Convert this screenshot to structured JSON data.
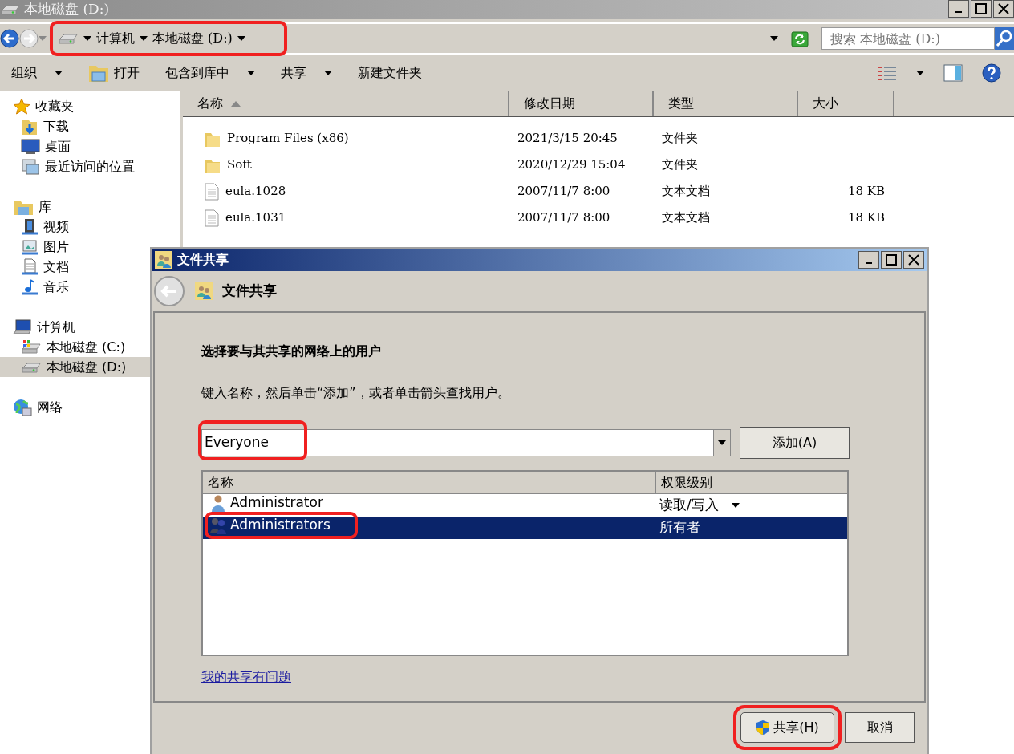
{
  "window": {
    "title": "本地磁盘 (D:)"
  },
  "address_bar": {
    "crumbs": [
      "计算机",
      "本地磁盘 (D:)"
    ],
    "highlighted": true
  },
  "search": {
    "placeholder": "搜索 本地磁盘 (D:)"
  },
  "toolbar": [
    {
      "label": "组织",
      "kind": "menu"
    },
    {
      "label": "打开",
      "kind": "open"
    },
    {
      "label": "包含到库中",
      "kind": "menu"
    },
    {
      "label": "共享",
      "kind": "menu"
    },
    {
      "label": "新建文件夹",
      "kind": "plain"
    }
  ],
  "nav": [
    {
      "label": "收藏夹",
      "kind": "favorites",
      "selected": false,
      "children": [
        {
          "label": "下载",
          "kind": "downloads",
          "selected": false
        },
        {
          "label": "桌面",
          "kind": "desktop",
          "selected": false
        },
        {
          "label": "最近访问的位置",
          "kind": "recent",
          "selected": false
        }
      ]
    },
    {
      "label": "库",
      "kind": "library",
      "selected": false,
      "children": [
        {
          "label": "视频",
          "kind": "video",
          "selected": false
        },
        {
          "label": "图片",
          "kind": "pictures",
          "selected": false
        },
        {
          "label": "文档",
          "kind": "documents",
          "selected": false
        },
        {
          "label": "音乐",
          "kind": "music",
          "selected": false
        }
      ]
    },
    {
      "label": "计算机",
      "kind": "computer",
      "selected": false,
      "children": [
        {
          "label": "本地磁盘 (C:)",
          "kind": "system-drive",
          "selected": false
        },
        {
          "label": "本地磁盘 (D:)",
          "kind": "drive",
          "selected": true
        }
      ]
    },
    {
      "label": "网络",
      "kind": "network",
      "selected": false
    }
  ],
  "files": {
    "columns": [
      {
        "label": "名称",
        "sorted": true
      },
      {
        "label": "修改日期",
        "sorted": false
      },
      {
        "label": "类型",
        "sorted": false
      },
      {
        "label": "大小",
        "sorted": false
      }
    ],
    "rows": [
      {
        "kind": "folder",
        "name": "Program Files (x86)",
        "modified": "2021/3/15 20:45",
        "type": "文件夹"
      },
      {
        "kind": "folder",
        "name": "Soft",
        "modified": "2020/12/29 15:04",
        "type": "文件夹"
      },
      {
        "kind": "text",
        "name": "eula.1028",
        "modified": "2007/11/7 8:00",
        "type": "文本文档",
        "size": "18 KB"
      },
      {
        "kind": "text",
        "name": "eula.1031",
        "modified": "2007/11/7 8:00",
        "type": "文本文档",
        "size": "18 KB"
      }
    ]
  },
  "share_dialog": {
    "title": "文件共享",
    "header": "文件共享",
    "heading": "选择要与其共享的网络上的用户",
    "instruction": "键入名称，然后单击“添加”，或者单击箭头查找用户。",
    "name_field": {
      "value": "Everyone",
      "highlighted": true
    },
    "add_button": "添加(A)",
    "list_columns": [
      "名称",
      "权限级别"
    ],
    "users": [
      {
        "kind": "user",
        "name": "Administrator",
        "permission": "读取/写入",
        "dropdown": true,
        "selected": false,
        "highlighted": false
      },
      {
        "kind": "group",
        "name": "Administrators",
        "permission": "所有者",
        "dropdown": false,
        "selected": true,
        "highlighted": true
      }
    ],
    "help_link": "我的共享有问题",
    "buttons": [
      {
        "label": "共享(H)",
        "kind": "elevated",
        "highlighted": true
      },
      {
        "label": "取消",
        "kind": "plain",
        "highlighted": false
      }
    ]
  }
}
